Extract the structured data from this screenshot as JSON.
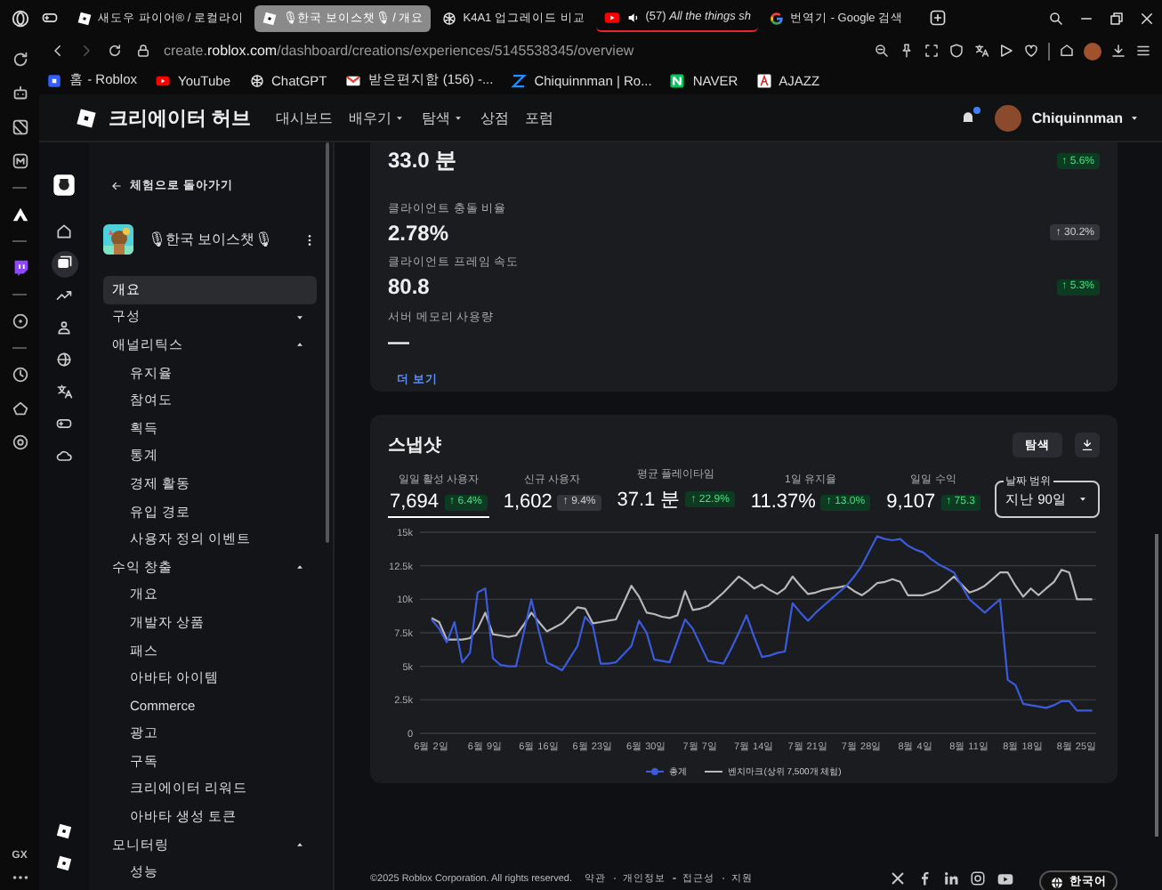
{
  "browser": {
    "tabs": [
      {
        "title": "새도우 파이어® / 로컬라이",
        "selected": false,
        "audio": false
      },
      {
        "title": "🎙한국 보이스챗🎙 / 개요",
        "selected": true,
        "audio": false
      },
      {
        "title": "K4A1 업그레이드 비교",
        "selected": false,
        "audio": false
      },
      {
        "title": "(57) *All the things sh*",
        "selected": false,
        "audio": true
      },
      {
        "title": "번역기 - Google 검색",
        "selected": false,
        "audio": false
      }
    ],
    "address": {
      "prefix": "create.",
      "host": "roblox.com",
      "path": "/dashboard/creations/experiences/5145538345/overview"
    },
    "bookmarks": [
      "홈 - Roblox",
      "YouTube",
      "ChatGPT",
      "받은편지함 (156) -...",
      "Chiquinnman | Ro...",
      "NAVER",
      "AJAZZ"
    ],
    "rail_label": "GX"
  },
  "header": {
    "title": "크리에이터 허브",
    "nav": [
      {
        "label": "대시보드",
        "dropdown": false
      },
      {
        "label": "배우기",
        "dropdown": true
      },
      {
        "label": "탐색",
        "dropdown": true
      },
      {
        "label": "상점",
        "dropdown": false
      },
      {
        "label": "포럼",
        "dropdown": false
      }
    ],
    "notification": true,
    "user": "Chiquinnman"
  },
  "icon_nav": {
    "items": [
      {
        "selected": false
      },
      {
        "selected": true
      },
      {
        "selected": false
      },
      {
        "selected": false
      },
      {
        "selected": false
      },
      {
        "selected": false
      },
      {
        "selected": false
      },
      {
        "selected": false
      }
    ]
  },
  "sidebar": {
    "back": "체험으로 돌아가기",
    "experience": "🎙한국 보이스챗🎙",
    "items": [
      {
        "label": "개요",
        "selected": true
      },
      {
        "label": "구성",
        "expanded": false
      },
      {
        "label": "애널리틱스",
        "expanded": true,
        "children": [
          {
            "label": "유지율",
            "selected": false
          },
          {
            "label": "참여도",
            "selected": false
          },
          {
            "label": "획득",
            "selected": false
          },
          {
            "label": "통계",
            "selected": false
          },
          {
            "label": "경제 활동",
            "selected": false
          },
          {
            "label": "유입 경로",
            "selected": false
          },
          {
            "label": "사용자 정의 이벤트",
            "selected": false
          }
        ]
      },
      {
        "label": "수익 창출",
        "expanded": true,
        "children": [
          {
            "label": "개요",
            "selected": false
          },
          {
            "label": "개발자 상품",
            "selected": false
          },
          {
            "label": "패스",
            "selected": false
          },
          {
            "label": "아바타 아이템",
            "selected": false
          },
          {
            "label": "Commerce",
            "selected": false
          },
          {
            "label": "광고",
            "selected": false
          },
          {
            "label": "구독",
            "selected": false
          },
          {
            "label": "크리에이터 리워드",
            "selected": false
          },
          {
            "label": "아바타 생성 토큰",
            "selected": false
          }
        ]
      },
      {
        "label": "모니터링",
        "expanded": true,
        "children": [
          {
            "label": "성능",
            "selected": false
          }
        ]
      }
    ]
  },
  "performance": {
    "metrics": [
      {
        "value": "33.0 분",
        "change": "↑ 5.6%",
        "positive": true
      },
      {
        "label": "클라이언트 충돌 비율",
        "value": "2.78%",
        "change": "↑ 30.2%",
        "positive": false
      },
      {
        "label": "클라이언트 프레임 속도",
        "value": "80.8",
        "change": "↑ 5.3%",
        "positive": true
      },
      {
        "label": "서버 메모리 사용량",
        "value": "—"
      }
    ],
    "more_link": "더 보기"
  },
  "snapshot": {
    "title": "스냅샷",
    "explore_button": "탐색",
    "tabs": [
      {
        "label": "일일 활성 사용자",
        "value": "7,694",
        "change": "↑ 6.4%",
        "positive": true,
        "selected": true
      },
      {
        "label": "신규 사용자",
        "value": "1,602",
        "change": "↑ 9.4%",
        "positive": false,
        "selected": false
      },
      {
        "label": "평균 플레이타임",
        "value": "37.1 분",
        "change": "↑ 22.9%",
        "positive": true,
        "selected": false
      },
      {
        "label": "1일 유지율",
        "value": "11.37%",
        "change": "↑ 13.0%",
        "positive": true,
        "selected": false
      },
      {
        "label": "일일 수익",
        "value": "9,107",
        "change": "↑ 75.3",
        "positive": true,
        "selected": false
      }
    ],
    "date_range": {
      "label": "날짜 범위",
      "value": "지난 90일"
    },
    "chart_data": {
      "type": "line",
      "categories": [
        "6월 2일",
        null,
        null,
        null,
        null,
        null,
        null,
        "6월 9일",
        null,
        null,
        null,
        null,
        null,
        null,
        "6월 16일",
        null,
        null,
        null,
        null,
        null,
        null,
        "6월 23일",
        null,
        null,
        null,
        null,
        null,
        null,
        "6월 30일",
        null,
        null,
        null,
        null,
        null,
        null,
        "7월 7일",
        null,
        null,
        null,
        null,
        null,
        null,
        "7월 14일",
        null,
        null,
        null,
        null,
        null,
        null,
        "7월 21일",
        null,
        null,
        null,
        null,
        null,
        null,
        "7월 28일",
        null,
        null,
        null,
        null,
        null,
        null,
        "8월 4일",
        null,
        null,
        null,
        null,
        null,
        null,
        "8월 11일",
        null,
        null,
        null,
        null,
        null,
        null,
        "8월 18일",
        null,
        null,
        null,
        null,
        null,
        null,
        "8월 25일",
        null,
        null
      ],
      "series": [
        {
          "name": "총계",
          "color": "#3b5bdb",
          "values": [
            8500,
            7800,
            6800,
            8300,
            5300,
            6000,
            10500,
            10800,
            5600,
            5100,
            5000,
            5000,
            7500,
            10000,
            7600,
            5300,
            5000,
            4700,
            5600,
            6500,
            8700,
            8000,
            5200,
            5200,
            5300,
            5900,
            6500,
            8400,
            7500,
            5500,
            5400,
            5300,
            6900,
            8500,
            7800,
            6600,
            5400,
            5300,
            5200,
            6300,
            7500,
            8800,
            7200,
            5700,
            5800,
            6000,
            6100,
            9700,
            9000,
            8400,
            9000,
            9500,
            10000,
            10500,
            11000,
            11700,
            12500,
            13600,
            14700,
            14500,
            14400,
            14500,
            14000,
            13700,
            13500,
            13000,
            12600,
            12300,
            12000,
            11000,
            10000,
            9500,
            9000,
            9500,
            10000,
            4000,
            3600,
            2200,
            2100,
            2000,
            1900,
            2100,
            2400,
            2400,
            1700,
            1700,
            1700
          ]
        },
        {
          "name": "벤치마크(상위 7,500개 체험)",
          "color": "#b8b8b8",
          "values": [
            8600,
            8300,
            7000,
            7000,
            7000,
            7100,
            7800,
            9000,
            7400,
            7300,
            7200,
            7300,
            8100,
            9000,
            8300,
            7600,
            7900,
            8200,
            8800,
            9400,
            9300,
            8200,
            8300,
            8400,
            8500,
            9700,
            11000,
            10200,
            9000,
            8900,
            8700,
            8600,
            8800,
            10600,
            9200,
            9300,
            9500,
            10000,
            10500,
            11100,
            11700,
            11300,
            10800,
            11100,
            10700,
            10400,
            10800,
            11700,
            11000,
            10400,
            10500,
            10700,
            10800,
            10900,
            11000,
            10600,
            10300,
            10700,
            11200,
            11300,
            11500,
            11300,
            10300,
            10300,
            10300,
            10500,
            10700,
            11200,
            11700,
            11100,
            10500,
            10700,
            11000,
            11500,
            12000,
            12000,
            11000,
            10200,
            10800,
            10300,
            10800,
            11300,
            12200,
            12000,
            10000,
            10000,
            10000
          ]
        }
      ],
      "ylim": [
        0,
        15000
      ],
      "grid": true,
      "legend": "bottom",
      "yticks": [
        {
          "value": 0,
          "label": "0"
        },
        {
          "value": 2500,
          "label": "2.5k"
        },
        {
          "value": 5000,
          "label": "5k"
        },
        {
          "value": 7500,
          "label": "7.5k"
        },
        {
          "value": 10000,
          "label": "10k"
        },
        {
          "value": 12500,
          "label": "12.5k"
        },
        {
          "value": 15000,
          "label": "15k"
        }
      ]
    }
  },
  "footer": {
    "copyright": "©2025 Roblox Corporation. All rights reserved.",
    "links": [
      "약관",
      "개인정보",
      "접근성",
      "지원"
    ],
    "language": "한국어"
  }
}
